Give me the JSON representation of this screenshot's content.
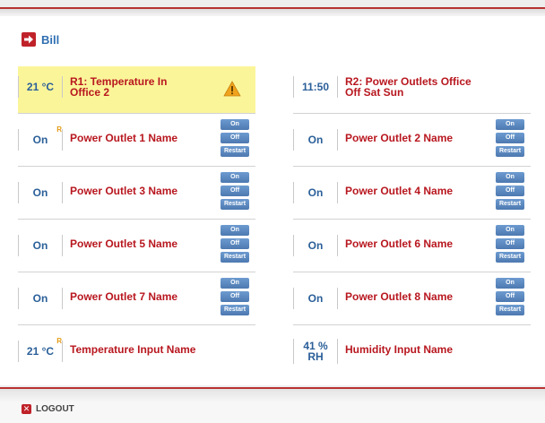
{
  "header": {
    "title": "Bill"
  },
  "colors": {
    "accent_red": "#b8171f",
    "value_blue": "#2a5f99",
    "button_blue": "#5a86be",
    "rule_highlight": "#fbf59a",
    "warning": "#f0a31c"
  },
  "left": {
    "rule": {
      "value": "21 °C",
      "name_line1": "R1: Temperature In",
      "name_line2": "Office 2",
      "icon": "warning-icon"
    },
    "outlets": [
      {
        "value": "On",
        "flag": "R",
        "name": "Power Outlet 1 Name"
      },
      {
        "value": "On",
        "flag": "",
        "name": "Power Outlet 3 Name"
      },
      {
        "value": "On",
        "flag": "",
        "name": "Power Outlet 5 Name"
      },
      {
        "value": "On",
        "flag": "",
        "name": "Power Outlet 7 Name"
      }
    ],
    "sensor": {
      "value": "21 °C",
      "flag": "R",
      "name": "Temperature Input Name"
    }
  },
  "right": {
    "rule": {
      "value": "11:50",
      "name_line1": "R2: Power Outlets Office",
      "name_line2": "Off Sat Sun"
    },
    "outlets": [
      {
        "value": "On",
        "flag": "",
        "name": "Power Outlet 2 Name"
      },
      {
        "value": "On",
        "flag": "",
        "name": "Power Outlet 4 Name"
      },
      {
        "value": "On",
        "flag": "",
        "name": "Power Outlet 6 Name"
      },
      {
        "value": "On",
        "flag": "",
        "name": "Power Outlet 8 Name"
      }
    ],
    "sensor": {
      "value_line1": "41 %",
      "value_line2": "RH",
      "name": "Humidity Input Name"
    }
  },
  "buttons": {
    "on": "On",
    "off": "Off",
    "restart": "Restart"
  },
  "footer": {
    "logout_label": "LOGOUT"
  }
}
